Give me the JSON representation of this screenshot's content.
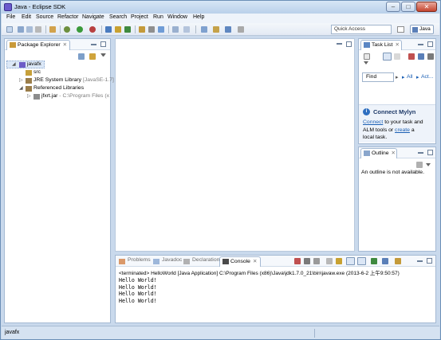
{
  "window": {
    "title": "Java - Eclipse SDK",
    "min_label": "–",
    "max_label": "□",
    "close_label": "✕"
  },
  "menu": [
    "File",
    "Edit",
    "Source",
    "Refactor",
    "Navigate",
    "Search",
    "Project",
    "Run",
    "Window",
    "Help"
  ],
  "toolbar": {
    "quick_access_placeholder": "Quick Access",
    "perspective_label": "Java"
  },
  "package_explorer": {
    "tab_label": "Package Explorer",
    "close_label": "✕",
    "tree": {
      "project": "javafx",
      "src": "src",
      "jre": "JRE System Library",
      "jre_version": "[JavaSE-1.7]",
      "referenced": "Referenced Libraries",
      "jar": "jfxrt.jar",
      "jar_path": "- C:\\Program Files (x"
    }
  },
  "task_list": {
    "tab_label": "Task List",
    "close_label": "✕",
    "find_placeholder": "Find",
    "all_label": "All",
    "activate_label": "Act..."
  },
  "mylyn": {
    "title": "Connect Mylyn",
    "connect_link": "Connect",
    "line1_rest": " to your task and",
    "line2_prefix": "ALM tools or ",
    "create_link": "create",
    "line2_suffix": " a",
    "line3": "local task."
  },
  "outline": {
    "tab_label": "Outline",
    "close_label": "✕",
    "message": "An outline is not available."
  },
  "bottom_tabs": {
    "problems": "Problems",
    "javadoc": "Javadoc",
    "declaration": "Declaration",
    "console": "Console",
    "console_close": "✕"
  },
  "console": {
    "header": "<terminated> HelloWorld [Java Application] C:\\Program Files (x86)\\Java\\jdk1.7.0_21\\bin\\javaw.exe (2013-6-2 上午9:50:57)",
    "lines": [
      "Hello World!",
      "Hello World!",
      "Hello World!",
      "Hello World!"
    ]
  },
  "status": {
    "text": "javafx"
  }
}
